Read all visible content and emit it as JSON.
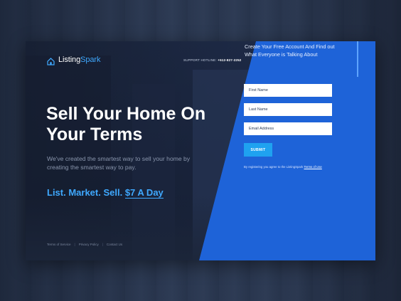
{
  "brand": {
    "name_part1": "Listing",
    "name_part2": "Spark",
    "accent_color": "#3fa9ff"
  },
  "header": {
    "hotline_label": "SUPPORT HOTLINE:",
    "hotline_number": "+512-827-2252"
  },
  "hero": {
    "headline": "Sell Your Home On Your Terms",
    "subtext": "We've created the smartest way to sell your home by creating the smartest way to pay.",
    "tagline_prefix": "List. Market. Sell. ",
    "tagline_price": "$7 A Day"
  },
  "footer": {
    "links": [
      "Terms of Service",
      "Privacy Policy",
      "Contact Us"
    ],
    "separator": "|"
  },
  "form": {
    "heading": "Create Your Free Account And Find out What Everyone is Talking About",
    "first_name_placeholder": "First Name",
    "last_name_placeholder": "Last Name",
    "email_placeholder": "Email Address",
    "submit_label": "SUBMIT",
    "legal_text": "By registering you agree to the ListingSpark ",
    "legal_link": "Terms of Use",
    "panel_color": "#1e63d8"
  }
}
